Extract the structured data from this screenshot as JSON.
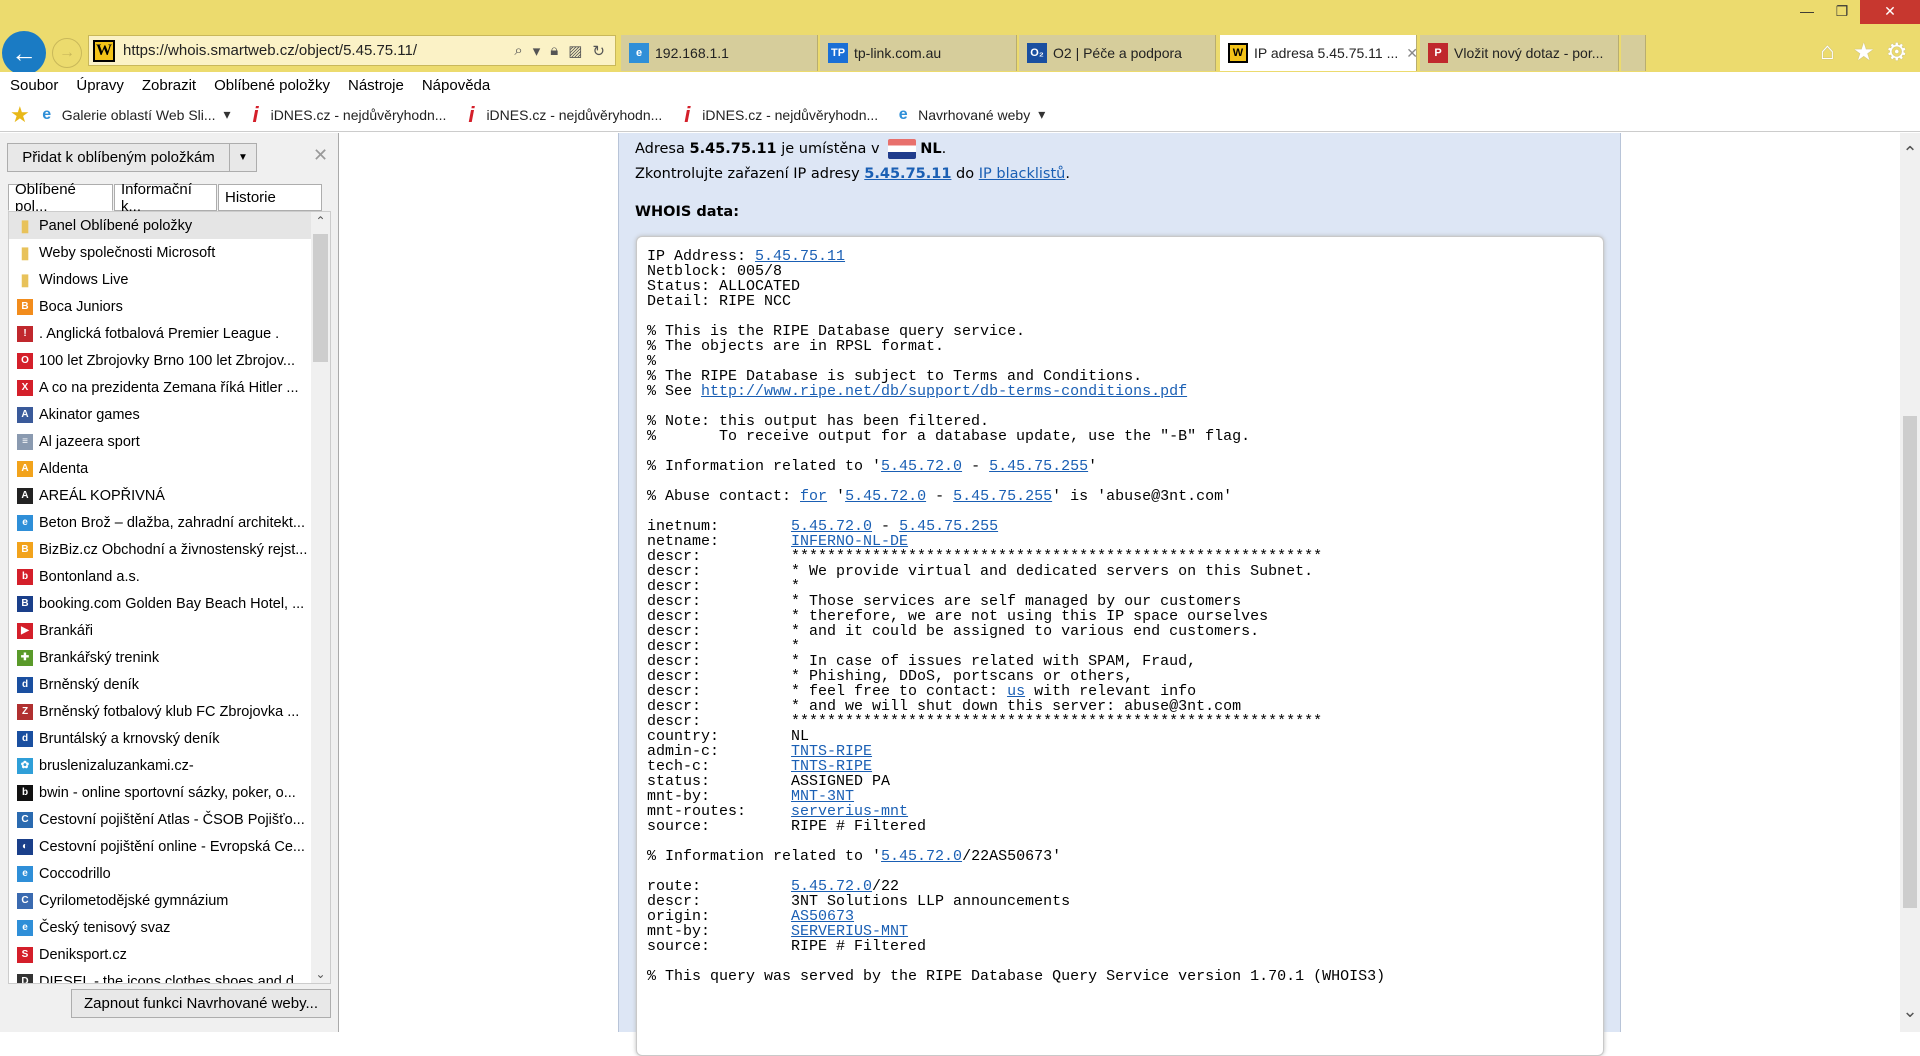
{
  "window": {
    "minimize": "—",
    "restore": "❐",
    "close": "✕"
  },
  "nav": {
    "back": "←",
    "forward": "→"
  },
  "address": {
    "url": "https://whois.smartweb.cz/object/5.45.75.11/",
    "site_icon": "W",
    "icons": [
      "search-icon",
      "dropdown-icon",
      "lock-icon",
      "compat-icon",
      "refresh-icon"
    ]
  },
  "tabs": [
    {
      "label": "192.168.1.1",
      "icon": "e",
      "color": "#2f8fd8"
    },
    {
      "label": "tp-link.com.au",
      "icon": "TP",
      "color": "#1a6fd6"
    },
    {
      "label": "O2 | Péče a podpora",
      "icon": "O₂",
      "color": "#1a4fa0"
    },
    {
      "label": "IP adresa 5.45.75.11 ...",
      "icon": "W",
      "color": "#f3c318",
      "active": true
    },
    {
      "label": "Vložit nový dotaz - por...",
      "icon": "P",
      "color": "#c0282d"
    }
  ],
  "tab_close": "✕",
  "toolbar_icons": {
    "home": "⌂",
    "favorites": "★",
    "settings": "⚙"
  },
  "menu": [
    "Soubor",
    "Úpravy",
    "Zobrazit",
    "Oblíbené položky",
    "Nástroje",
    "Nápověda"
  ],
  "favbar": [
    {
      "label": "Galerie oblastí Web Sli...",
      "icon": "e",
      "color": "#2f8fd8",
      "dropdown": "▾"
    },
    {
      "label": "iDNES.cz - nejdůvěryhodn...",
      "icon": "i",
      "color": "#d41f2a"
    },
    {
      "label": "iDNES.cz - nejdůvěryhodn...",
      "icon": "i",
      "color": "#d41f2a"
    },
    {
      "label": "iDNES.cz - nejdůvěryhodn...",
      "icon": "i",
      "color": "#d41f2a"
    },
    {
      "label": "Navrhované weby",
      "icon": "e",
      "color": "#2f8fd8",
      "dropdown": "▾"
    }
  ],
  "sidebar": {
    "add_button": "Přidat k oblíbeným položkám",
    "close": "✕",
    "tabs": [
      "Oblíbené pol...",
      "Informační k...",
      "Historie"
    ],
    "items": [
      {
        "label": "Panel Oblíbené položky",
        "icon": "▮",
        "color": "#e8c25a"
      },
      {
        "label": "Weby společnosti Microsoft",
        "icon": "▮",
        "color": "#e8c25a"
      },
      {
        "label": "Windows Live",
        "icon": "▮",
        "color": "#e8c25a"
      },
      {
        "label": "Boca Juniors",
        "icon": "B",
        "color": "#f28c1c"
      },
      {
        "label": ". Anglická fotbalová Premier League .",
        "icon": "!",
        "color": "#c0282d"
      },
      {
        "label": "100 let Zbrojovky Brno 100 let Zbrojov...",
        "icon": "O",
        "color": "#d41f2a"
      },
      {
        "label": "A co na prezidenta Zemana říká Hitler ...",
        "icon": "X",
        "color": "#d41f2a"
      },
      {
        "label": "Akinator games",
        "icon": "A",
        "color": "#3a5a9a"
      },
      {
        "label": "Al jazeera sport",
        "icon": "≡",
        "color": "#8a9ab0"
      },
      {
        "label": "Aldenta",
        "icon": "A",
        "color": "#f2a31c"
      },
      {
        "label": "AREÁL KOPŘIVNÁ",
        "icon": "A",
        "color": "#222222"
      },
      {
        "label": "Beton Brož – dlažba, zahradní architekt...",
        "icon": "e",
        "color": "#2f8fd8"
      },
      {
        "label": "BizBiz.cz  Obchodní a živnostenský rejst...",
        "icon": "B",
        "color": "#f2a31c"
      },
      {
        "label": "Bontonland a.s.",
        "icon": "b",
        "color": "#d41f2a"
      },
      {
        "label": "booking.com Golden Bay Beach Hotel, ...",
        "icon": "B",
        "color": "#1a3f8a"
      },
      {
        "label": "Brankáři",
        "icon": "▶",
        "color": "#d41f2a"
      },
      {
        "label": "Brankářský trenink",
        "icon": "✚",
        "color": "#5a9a2a"
      },
      {
        "label": "Brněnský deník",
        "icon": "d",
        "color": "#1a4fa0"
      },
      {
        "label": "Brněnský fotbalový klub  FC Zbrojovka ...",
        "icon": "Z",
        "color": "#b03030"
      },
      {
        "label": "Bruntálský a krnovský deník",
        "icon": "d",
        "color": "#1a4fa0"
      },
      {
        "label": "bruslenizaluzankami.cz-",
        "icon": "✿",
        "color": "#2f9fd8"
      },
      {
        "label": "bwin - online sportovní sázky, poker, o...",
        "icon": "b",
        "color": "#111111"
      },
      {
        "label": "Cestovní pojištění Atlas - ČSOB Pojišťo...",
        "icon": "C",
        "color": "#2a6ab0"
      },
      {
        "label": "Cestovní pojištění online - Evropská Ce...",
        "icon": "◐",
        "color": "#1a3f8a"
      },
      {
        "label": "Coccodrillo",
        "icon": "e",
        "color": "#2f8fd8"
      },
      {
        "label": "Cyrilometodějské gymnázium",
        "icon": "C",
        "color": "#3a6ab0"
      },
      {
        "label": "Český tenisový svaz",
        "icon": "e",
        "color": "#2f8fd8"
      },
      {
        "label": "Deniksport.cz",
        "icon": "S",
        "color": "#d41f2a"
      },
      {
        "label": "DIESEL - the icons clothes shoes and d...",
        "icon": "D",
        "color": "#333333"
      }
    ],
    "scroll_up": "⌃",
    "scroll_down": "⌄",
    "suggest_button": "Zapnout funkci Navrhované weby..."
  },
  "page": {
    "loc_prefix": "Adresa ",
    "ip": "5.45.75.11",
    "loc_mid": " je umístěna v ",
    "country": "NL",
    "loc_end": ".",
    "check_prefix": "Zkontrolujte zařazení IP adresy ",
    "check_mid": " do ",
    "blacklist_link": "IP blacklistů",
    "check_end": ".",
    "whois_heading": "WHOIS data:",
    "whois_lines": [
      [
        {
          "t": "IP Address: "
        },
        {
          "t": "5.45.75.11",
          "l": 1
        }
      ],
      [
        {
          "t": "Netblock: 005/8"
        }
      ],
      [
        {
          "t": "Status: ALLOCATED"
        }
      ],
      [
        {
          "t": "Detail: RIPE NCC"
        }
      ],
      [],
      [
        {
          "t": "% This is the RIPE Database query service."
        }
      ],
      [
        {
          "t": "% The objects are in RPSL format."
        }
      ],
      [
        {
          "t": "%"
        }
      ],
      [
        {
          "t": "% The RIPE Database is subject to Terms and Conditions."
        }
      ],
      [
        {
          "t": "% See "
        },
        {
          "t": "http://www.ripe.net/db/support/db-terms-conditions.pdf",
          "l": 1
        }
      ],
      [],
      [
        {
          "t": "% Note: this output has been filtered."
        }
      ],
      [
        {
          "t": "%       To receive output for a database update, use the \"-B\" flag."
        }
      ],
      [],
      [
        {
          "t": "% Information related to '"
        },
        {
          "t": "5.45.72.0",
          "l": 1
        },
        {
          "t": " - "
        },
        {
          "t": "5.45.75.255",
          "l": 1
        },
        {
          "t": "'"
        }
      ],
      [],
      [
        {
          "t": "% Abuse contact: "
        },
        {
          "t": "for",
          "l": 1
        },
        {
          "t": " '"
        },
        {
          "t": "5.45.72.0",
          "l": 1
        },
        {
          "t": " - "
        },
        {
          "t": "5.45.75.255",
          "l": 1
        },
        {
          "t": "' is 'abuse@3nt.com'"
        }
      ],
      [],
      [
        {
          "t": "inetnum:        "
        },
        {
          "t": "5.45.72.0",
          "l": 1
        },
        {
          "t": " - "
        },
        {
          "t": "5.45.75.255",
          "l": 1
        }
      ],
      [
        {
          "t": "netname:        "
        },
        {
          "t": "INFERNO-NL-DE",
          "l": 1
        }
      ],
      [
        {
          "t": "descr:          ***********************************************************"
        }
      ],
      [
        {
          "t": "descr:          * We provide virtual and dedicated servers on this Subnet."
        }
      ],
      [
        {
          "t": "descr:          *"
        }
      ],
      [
        {
          "t": "descr:          * Those services are self managed by our customers"
        }
      ],
      [
        {
          "t": "descr:          * therefore, we are not using this IP space ourselves"
        }
      ],
      [
        {
          "t": "descr:          * and it could be assigned to various end customers."
        }
      ],
      [
        {
          "t": "descr:          *"
        }
      ],
      [
        {
          "t": "descr:          * In case of issues related with SPAM, Fraud,"
        }
      ],
      [
        {
          "t": "descr:          * Phishing, DDoS, portscans or others,"
        }
      ],
      [
        {
          "t": "descr:          * feel free to contact: "
        },
        {
          "t": "us",
          "l": 1
        },
        {
          "t": " with relevant info"
        }
      ],
      [
        {
          "t": "descr:          * and we will shut down this server: abuse@3nt.com"
        }
      ],
      [
        {
          "t": "descr:          ***********************************************************"
        }
      ],
      [
        {
          "t": "country:        NL"
        }
      ],
      [
        {
          "t": "admin-c:        "
        },
        {
          "t": "TNTS-RIPE",
          "l": 1
        }
      ],
      [
        {
          "t": "tech-c:         "
        },
        {
          "t": "TNTS-RIPE",
          "l": 1
        }
      ],
      [
        {
          "t": "status:         ASSIGNED PA"
        }
      ],
      [
        {
          "t": "mnt-by:         "
        },
        {
          "t": "MNT-3NT",
          "l": 1
        }
      ],
      [
        {
          "t": "mnt-routes:     "
        },
        {
          "t": "serverius-mnt",
          "l": 1
        }
      ],
      [
        {
          "t": "source:         RIPE # Filtered"
        }
      ],
      [],
      [
        {
          "t": "% Information related to '"
        },
        {
          "t": "5.45.72.0",
          "l": 1
        },
        {
          "t": "/22AS50673'"
        }
      ],
      [],
      [
        {
          "t": "route:          "
        },
        {
          "t": "5.45.72.0",
          "l": 1
        },
        {
          "t": "/22"
        }
      ],
      [
        {
          "t": "descr:          3NT Solutions LLP announcements"
        }
      ],
      [
        {
          "t": "origin:         "
        },
        {
          "t": "AS50673",
          "l": 1
        }
      ],
      [
        {
          "t": "mnt-by:         "
        },
        {
          "t": "SERVERIUS-MNT",
          "l": 1
        }
      ],
      [
        {
          "t": "source:         RIPE # Filtered"
        }
      ],
      [],
      [
        {
          "t": "% This query was served by the RIPE Database Query Service version 1.70.1 (WHOIS3)"
        }
      ]
    ]
  },
  "scrollbar": {
    "up": "⌃",
    "down": "⌄"
  }
}
